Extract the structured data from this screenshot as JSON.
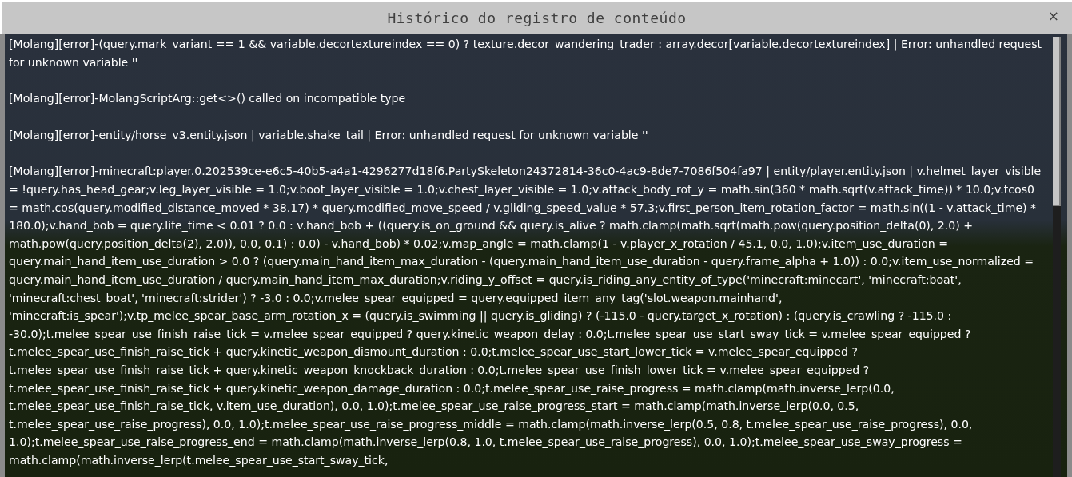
{
  "window": {
    "title": "Histórico do registro de conteúdo",
    "close_label": "×"
  },
  "log_entries": [
    {
      "text": "[Molang][error]-(query.mark_variant == 1 && variable.decortextureindex == 0) ? texture.decor_wandering_trader : array.decor[variable.decortextureindex] | Error: unhandled request for unknown variable ''"
    },
    {
      "text": "[Molang][error]-MolangScriptArg::get<>() called on incompatible type"
    },
    {
      "text": "[Molang][error]-entity/horse_v3.entity.json | variable.shake_tail | Error: unhandled request for unknown variable ''"
    },
    {
      "text": "[Molang][error]-minecraft:player.0.202539ce-e6c5-40b5-a4a1-4296277d18f6.PartySkeleton24372814-36c0-4ac9-8de7-7086f504fa97 | entity/player.entity.json | v.helmet_layer_visible = !query.has_head_gear;v.leg_layer_visible = 1.0;v.boot_layer_visible = 1.0;v.chest_layer_visible = 1.0;v.attack_body_rot_y = math.sin(360 * math.sqrt(v.attack_time)) * 10.0;v.tcos0 = math.cos(query.modified_distance_moved * 38.17) * query.modified_move_speed / v.gliding_speed_value * 57.3;v.first_person_item_rotation_factor = math.sin((1 - v.attack_time) * 180.0);v.hand_bob = query.life_time < 0.01 ? 0.0 : v.hand_bob + ((query.is_on_ground && query.is_alive ? math.clamp(math.sqrt(math.pow(query.position_delta(0), 2.0) + math.pow(query.position_delta(2), 2.0)), 0.0, 0.1) : 0.0) - v.hand_bob) * 0.02;v.map_angle = math.clamp(1 - v.player_x_rotation / 45.1, 0.0, 1.0);v.item_use_duration = query.main_hand_item_use_duration > 0.0 ? (query.main_hand_item_max_duration - (query.main_hand_item_use_duration - query.frame_alpha + 1.0)) : 0.0;v.item_use_normalized = query.main_hand_item_use_duration / query.main_hand_item_max_duration;v.riding_y_offset = query.is_riding_any_entity_of_type('minecraft:minecart', 'minecraft:boat', 'minecraft:chest_boat', 'minecraft:strider') ? -3.0 : 0.0;v.melee_spear_equipped = query.equipped_item_any_tag('slot.weapon.mainhand', 'minecraft:is_spear');v.tp_melee_spear_base_arm_rotation_x = (query.is_swimming || query.is_gliding) ? (-115.0 - query.target_x_rotation) : (query.is_crawling ? -115.0 : -30.0);t.melee_spear_use_finish_raise_tick = v.melee_spear_equipped ? query.kinetic_weapon_delay : 0.0;t.melee_spear_use_start_sway_tick = v.melee_spear_equipped ? t.melee_spear_use_finish_raise_tick + query.kinetic_weapon_dismount_duration : 0.0;t.melee_spear_use_start_lower_tick = v.melee_spear_equipped ? t.melee_spear_use_finish_raise_tick + query.kinetic_weapon_knockback_duration : 0.0;t.melee_spear_use_finish_lower_tick = v.melee_spear_equipped ? t.melee_spear_use_finish_raise_tick + query.kinetic_weapon_damage_duration : 0.0;t.melee_spear_use_raise_progress = math.clamp(math.inverse_lerp(0.0, t.melee_spear_use_finish_raise_tick, v.item_use_duration), 0.0, 1.0);t.melee_spear_use_raise_progress_start = math.clamp(math.inverse_lerp(0.0, 0.5, t.melee_spear_use_raise_progress), 0.0, 1.0);t.melee_spear_use_raise_progress_middle = math.clamp(math.inverse_lerp(0.5, 0.8, t.melee_spear_use_raise_progress), 0.0, 1.0);t.melee_spear_use_raise_progress_end = math.clamp(math.inverse_lerp(0.8, 1.0, t.melee_spear_use_raise_progress), 0.0, 1.0);t.melee_spear_use_sway_progress = math.clamp(math.inverse_lerp(t.melee_spear_use_start_sway_tick,"
    }
  ]
}
